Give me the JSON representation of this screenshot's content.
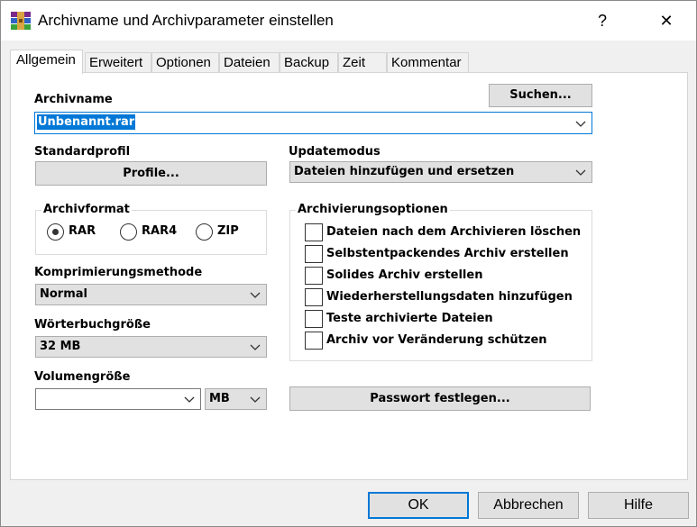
{
  "window": {
    "title": "Archivname und Archivparameter einstellen",
    "help_label": "?",
    "close_label": "✕"
  },
  "tabs": [
    {
      "label": "Allgemein",
      "active": true
    },
    {
      "label": "Erweitert"
    },
    {
      "label": "Optionen"
    },
    {
      "label": "Dateien"
    },
    {
      "label": "Backup"
    },
    {
      "label": "Zeit"
    },
    {
      "label": "Kommentar"
    }
  ],
  "general": {
    "archive_name_label": "Archivname",
    "browse_label": "Suchen...",
    "archive_name_value": "Unbenannt.rar",
    "default_profile_label": "Standardprofil",
    "profiles_button": "Profile...",
    "update_mode_label": "Updatemodus",
    "update_mode_value": "Dateien hinzufügen und ersetzen",
    "archive_format": {
      "title": "Archivformat",
      "options": [
        "RAR",
        "RAR4",
        "ZIP"
      ],
      "selected": "RAR"
    },
    "compression_label": "Komprimierungsmethode",
    "compression_value": "Normal",
    "dictionary_label": "Wörterbuchgröße",
    "dictionary_value": "32 MB",
    "volume_label": "Volumengröße",
    "volume_value": "",
    "volume_unit": "MB",
    "archiving_options": {
      "title": "Archivierungsoptionen",
      "items": [
        {
          "label": "Dateien nach dem Archivieren löschen",
          "checked": false
        },
        {
          "label": "Selbstentpackendes Archiv erstellen",
          "checked": false
        },
        {
          "label": "Solides Archiv erstellen",
          "checked": false
        },
        {
          "label": "Wiederherstellungsdaten hinzufügen",
          "checked": false
        },
        {
          "label": "Teste archivierte Dateien",
          "checked": false
        },
        {
          "label": "Archiv vor Veränderung schützen",
          "checked": false
        }
      ]
    },
    "password_button": "Passwort festlegen..."
  },
  "footer": {
    "ok_label": "OK",
    "cancel_label": "Abbrechen",
    "help_label": "Hilfe"
  },
  "colors": {
    "accent": "#0078d7",
    "button_face": "#e1e1e1",
    "dialog_bg": "#f0f0f0"
  }
}
